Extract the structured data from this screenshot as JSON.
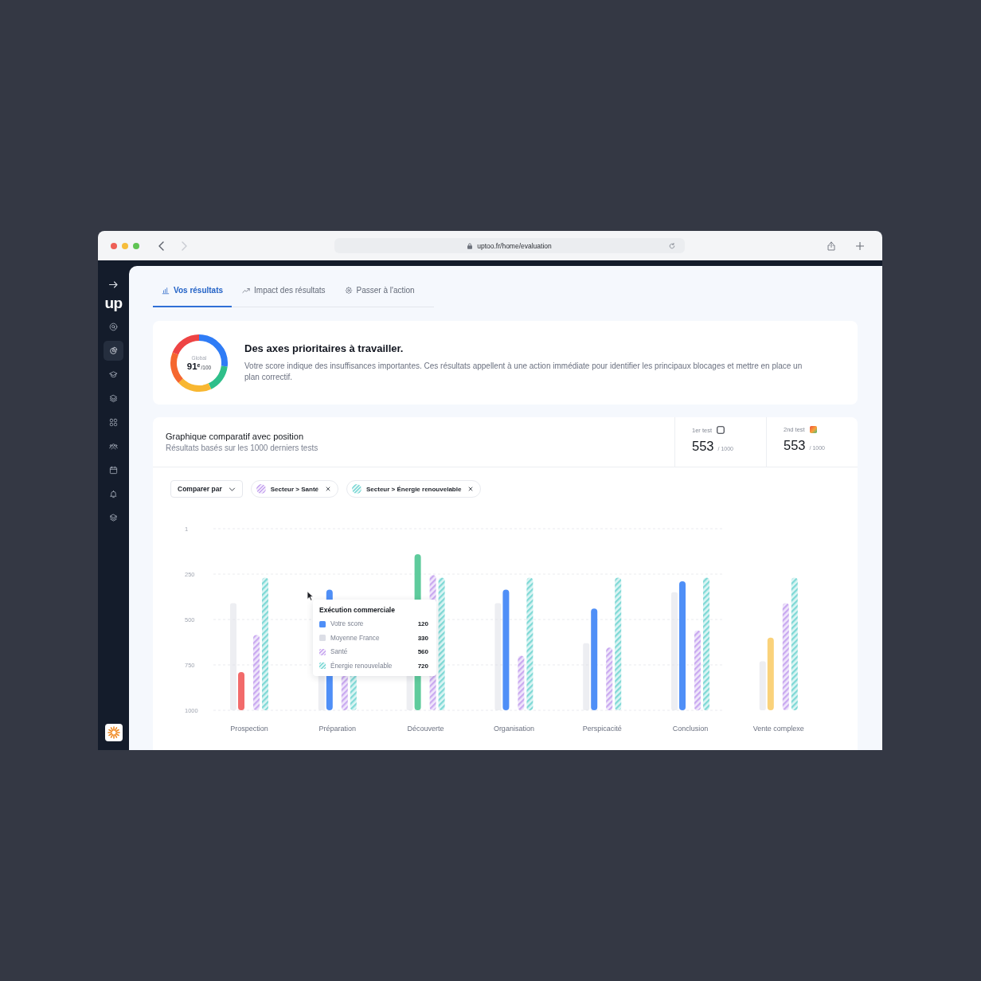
{
  "browser": {
    "url": "uptoo.fr/home/evaluation"
  },
  "sidebar": {
    "logo": "up",
    "items": [
      {
        "selected": false
      },
      {
        "selected": true
      },
      {
        "selected": false
      },
      {
        "selected": false
      },
      {
        "selected": false
      },
      {
        "selected": false
      },
      {
        "selected": false
      },
      {
        "selected": false
      },
      {
        "selected": false
      }
    ]
  },
  "tabs": [
    {
      "label": "Vos résultats",
      "selected": true
    },
    {
      "label": "Impact des résultats",
      "selected": false
    },
    {
      "label": "Passer à l'action",
      "selected": false
    }
  ],
  "summary": {
    "caption": "Global",
    "rank": "91$^{e}$",
    "total": "/100",
    "title": "Des axes prioritaires à travailler.",
    "text": "Votre score indique des insuffisances importantes. Ces résultats appellent à une action immédiate pour identifier les principaux blocages et mettre en place un plan correctif."
  },
  "comparison": {
    "title": "Graphique comparatif avec position",
    "subtitle": "Résultats basés sur les 1000 derniers tests",
    "stats": [
      {
        "label": "1er test",
        "kind": "outline",
        "value": "553",
        "total": "/ 1000"
      },
      {
        "label": "2nd test",
        "kind": "gradient",
        "value": "553",
        "total": "/ 1000"
      }
    ],
    "compare_button": "Comparer par",
    "filters": [
      {
        "label": "Secteur > Santé",
        "color": "#c9a9f0"
      },
      {
        "label": "Secteur > Énergie renouvelable",
        "color": "#7fd9d6"
      }
    ],
    "chart": {
      "y_axis_labels": [
        "1",
        "250",
        "500",
        "750",
        "1000"
      ],
      "categories": [
        {
          "label": "Prospection",
          "color": "#f26b6b"
        },
        {
          "label": "Préparation",
          "color": "#4f8ff7"
        },
        {
          "label": "Découverte",
          "color": "#5ecb9c"
        },
        {
          "label": "Organisation",
          "color": "#4f8ff7"
        },
        {
          "label": "Perspicacité",
          "color": "#4f8ff7"
        },
        {
          "label": "Conclusion",
          "color": "#4f8ff7"
        },
        {
          "label": "Vente complexe",
          "color": "#fad27a"
        }
      ]
    },
    "tooltip": {
      "title": "Exécution commerciale",
      "rows": [
        {
          "label": "Votre score",
          "value": "120",
          "kind": "solid",
          "color": "#4f8ff7"
        },
        {
          "label": "Moyenne France",
          "value": "330",
          "kind": "solid",
          "color": "#dcdee6"
        },
        {
          "label": "Santé",
          "value": "560",
          "kind": "hatched",
          "color": "#c9a9f0"
        },
        {
          "label": "Énergie renouvelable",
          "value": "720",
          "kind": "hatched",
          "color": "#7fd9d6"
        }
      ]
    }
  }
}
